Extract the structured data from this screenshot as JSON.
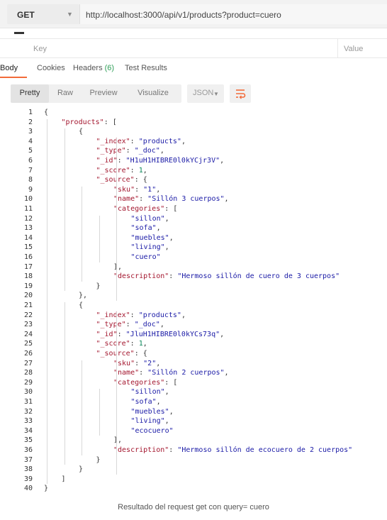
{
  "request": {
    "method": "GET",
    "url": "http://localhost:3000/api/v1/products?product=cuero"
  },
  "params": {
    "key_placeholder": "Key",
    "value_placeholder": "Value"
  },
  "response_tabs": [
    {
      "label": "Body"
    },
    {
      "label": "Cookies"
    },
    {
      "label": "Headers",
      "count": "(6)"
    },
    {
      "label": "Test Results"
    }
  ],
  "toolbar": {
    "pretty": "Pretty",
    "raw": "Raw",
    "preview": "Preview",
    "visualize": "Visualize",
    "format": "JSON",
    "wrap_icon": "wrap-lines-icon"
  },
  "colors": {
    "accent": "#f26b3a",
    "json_key": "#a3152d",
    "json_string": "#1a1aa6",
    "json_number": "#098658",
    "count": "#2e9e57"
  },
  "code_lines": [
    {
      "n": "1",
      "indent": 0,
      "tokens": [
        [
          "punc",
          "{"
        ]
      ]
    },
    {
      "n": "2",
      "indent": 1,
      "tokens": [
        [
          "key",
          "\"products\""
        ],
        [
          "punc",
          ": ["
        ]
      ]
    },
    {
      "n": "3",
      "indent": 2,
      "tokens": [
        [
          "punc",
          "{"
        ]
      ]
    },
    {
      "n": "4",
      "indent": 3,
      "tokens": [
        [
          "key",
          "\"_index\""
        ],
        [
          "punc",
          ": "
        ],
        [
          "str",
          "\"products\""
        ],
        [
          "punc",
          ","
        ]
      ]
    },
    {
      "n": "5",
      "indent": 3,
      "tokens": [
        [
          "key",
          "\"_type\""
        ],
        [
          "punc",
          ": "
        ],
        [
          "str",
          "\"_doc\""
        ],
        [
          "punc",
          ","
        ]
      ]
    },
    {
      "n": "6",
      "indent": 3,
      "tokens": [
        [
          "key",
          "\"_id\""
        ],
        [
          "punc",
          ": "
        ],
        [
          "str",
          "\"H1uH1HIBRE0l0kYCjr3V\""
        ],
        [
          "punc",
          ","
        ]
      ]
    },
    {
      "n": "7",
      "indent": 3,
      "tokens": [
        [
          "key",
          "\"_score\""
        ],
        [
          "punc",
          ": "
        ],
        [
          "num",
          "1"
        ],
        [
          "punc",
          ","
        ]
      ]
    },
    {
      "n": "8",
      "indent": 3,
      "tokens": [
        [
          "key",
          "\"_source\""
        ],
        [
          "punc",
          ": {"
        ]
      ]
    },
    {
      "n": "9",
      "indent": 4,
      "tokens": [
        [
          "key",
          "\"sku\""
        ],
        [
          "punc",
          ": "
        ],
        [
          "str",
          "\"1\""
        ],
        [
          "punc",
          ","
        ]
      ]
    },
    {
      "n": "10",
      "indent": 4,
      "tokens": [
        [
          "key",
          "\"name\""
        ],
        [
          "punc",
          ": "
        ],
        [
          "str",
          "\"Sillón 3 cuerpos\""
        ],
        [
          "punc",
          ","
        ]
      ]
    },
    {
      "n": "11",
      "indent": 4,
      "tokens": [
        [
          "key",
          "\"categories\""
        ],
        [
          "punc",
          ": ["
        ]
      ]
    },
    {
      "n": "12",
      "indent": 5,
      "tokens": [
        [
          "str",
          "\"sillon\""
        ],
        [
          "punc",
          ","
        ]
      ]
    },
    {
      "n": "13",
      "indent": 5,
      "tokens": [
        [
          "str",
          "\"sofa\""
        ],
        [
          "punc",
          ","
        ]
      ]
    },
    {
      "n": "14",
      "indent": 5,
      "tokens": [
        [
          "str",
          "\"muebles\""
        ],
        [
          "punc",
          ","
        ]
      ]
    },
    {
      "n": "15",
      "indent": 5,
      "tokens": [
        [
          "str",
          "\"living\""
        ],
        [
          "punc",
          ","
        ]
      ]
    },
    {
      "n": "16",
      "indent": 5,
      "tokens": [
        [
          "str",
          "\"cuero\""
        ]
      ]
    },
    {
      "n": "17",
      "indent": 4,
      "tokens": [
        [
          "punc",
          "],"
        ]
      ]
    },
    {
      "n": "18",
      "indent": 4,
      "tokens": [
        [
          "key",
          "\"description\""
        ],
        [
          "punc",
          ": "
        ],
        [
          "str",
          "\"Hermoso sillón de cuero de 3 cuerpos\""
        ]
      ]
    },
    {
      "n": "19",
      "indent": 3,
      "tokens": [
        [
          "punc",
          "}"
        ]
      ]
    },
    {
      "n": "20",
      "indent": 2,
      "tokens": [
        [
          "punc",
          "},"
        ]
      ]
    },
    {
      "n": "21",
      "indent": 2,
      "tokens": [
        [
          "punc",
          "{"
        ]
      ]
    },
    {
      "n": "22",
      "indent": 3,
      "tokens": [
        [
          "key",
          "\"_index\""
        ],
        [
          "punc",
          ": "
        ],
        [
          "str",
          "\"products\""
        ],
        [
          "punc",
          ","
        ]
      ]
    },
    {
      "n": "23",
      "indent": 3,
      "tokens": [
        [
          "key",
          "\"_type\""
        ],
        [
          "punc",
          ": "
        ],
        [
          "str",
          "\"_doc\""
        ],
        [
          "punc",
          ","
        ]
      ]
    },
    {
      "n": "24",
      "indent": 3,
      "tokens": [
        [
          "key",
          "\"_id\""
        ],
        [
          "punc",
          ": "
        ],
        [
          "str",
          "\"JluH1HIBRE0l0kYCs73q\""
        ],
        [
          "punc",
          ","
        ]
      ]
    },
    {
      "n": "25",
      "indent": 3,
      "tokens": [
        [
          "key",
          "\"_score\""
        ],
        [
          "punc",
          ": "
        ],
        [
          "num",
          "1"
        ],
        [
          "punc",
          ","
        ]
      ]
    },
    {
      "n": "26",
      "indent": 3,
      "tokens": [
        [
          "key",
          "\"_source\""
        ],
        [
          "punc",
          ": {"
        ]
      ]
    },
    {
      "n": "27",
      "indent": 4,
      "tokens": [
        [
          "key",
          "\"sku\""
        ],
        [
          "punc",
          ": "
        ],
        [
          "str",
          "\"2\""
        ],
        [
          "punc",
          ","
        ]
      ]
    },
    {
      "n": "28",
      "indent": 4,
      "tokens": [
        [
          "key",
          "\"name\""
        ],
        [
          "punc",
          ": "
        ],
        [
          "str",
          "\"Sillón 2 cuerpos\""
        ],
        [
          "punc",
          ","
        ]
      ]
    },
    {
      "n": "29",
      "indent": 4,
      "tokens": [
        [
          "key",
          "\"categories\""
        ],
        [
          "punc",
          ": ["
        ]
      ]
    },
    {
      "n": "30",
      "indent": 5,
      "tokens": [
        [
          "str",
          "\"sillon\""
        ],
        [
          "punc",
          ","
        ]
      ]
    },
    {
      "n": "31",
      "indent": 5,
      "tokens": [
        [
          "str",
          "\"sofa\""
        ],
        [
          "punc",
          ","
        ]
      ]
    },
    {
      "n": "32",
      "indent": 5,
      "tokens": [
        [
          "str",
          "\"muebles\""
        ],
        [
          "punc",
          ","
        ]
      ]
    },
    {
      "n": "33",
      "indent": 5,
      "tokens": [
        [
          "str",
          "\"living\""
        ],
        [
          "punc",
          ","
        ]
      ]
    },
    {
      "n": "34",
      "indent": 5,
      "tokens": [
        [
          "str",
          "\"ecocuero\""
        ]
      ]
    },
    {
      "n": "35",
      "indent": 4,
      "tokens": [
        [
          "punc",
          "],"
        ]
      ]
    },
    {
      "n": "36",
      "indent": 4,
      "tokens": [
        [
          "key",
          "\"description\""
        ],
        [
          "punc",
          ": "
        ],
        [
          "str",
          "\"Hermoso sillón de ecocuero de 2 cuerpos\""
        ]
      ]
    },
    {
      "n": "37",
      "indent": 3,
      "tokens": [
        [
          "punc",
          "}"
        ]
      ]
    },
    {
      "n": "38",
      "indent": 2,
      "tokens": [
        [
          "punc",
          "}"
        ]
      ]
    },
    {
      "n": "39",
      "indent": 1,
      "tokens": [
        [
          "punc",
          "]"
        ]
      ]
    },
    {
      "n": "40",
      "indent": 0,
      "tokens": [
        [
          "punc",
          "}"
        ]
      ]
    }
  ],
  "caption": "Resultado del request get con query= cuero"
}
